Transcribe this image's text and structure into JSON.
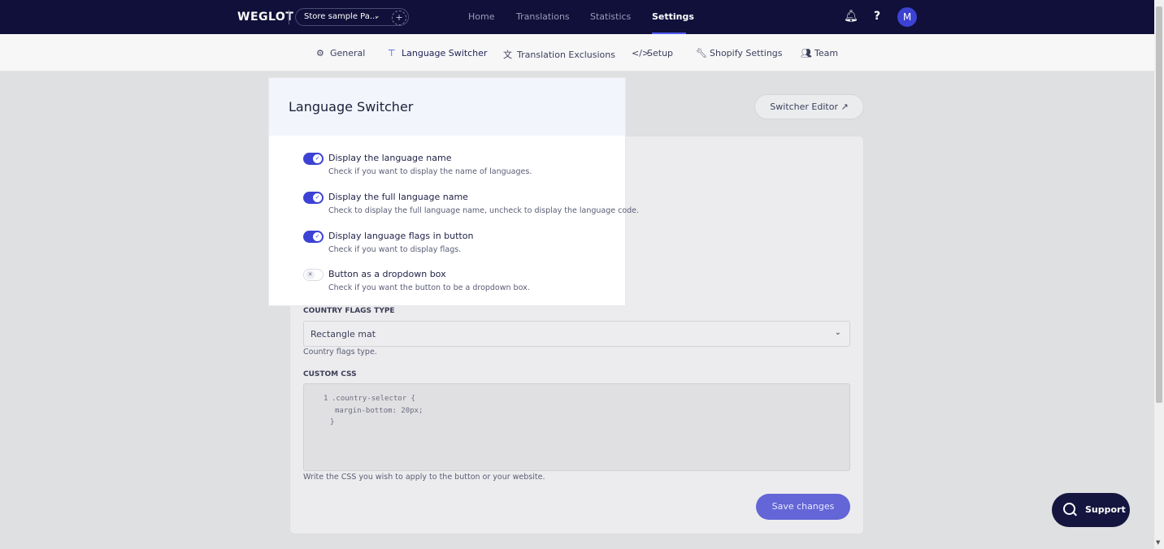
{
  "topbar": {
    "logo": "WEGLOT",
    "project": "Store sample Pa...",
    "project_add": "+",
    "nav": [
      "Home",
      "Translations",
      "Statistics",
      "Settings"
    ],
    "active_nav": "Settings",
    "avatar_initial": "M"
  },
  "subtabs": [
    {
      "label": "General",
      "icon": "gear-icon"
    },
    {
      "label": "Language Switcher",
      "icon": "paint-roller-icon"
    },
    {
      "label": "Translation Exclusions",
      "icon": "translate-icon"
    },
    {
      "label": "Setup",
      "icon": "code-icon"
    },
    {
      "label": "Shopify Settings",
      "icon": "wrench-icon"
    },
    {
      "label": "Team",
      "icon": "team-icon"
    }
  ],
  "page": {
    "switcher_editor_label": "Switcher Editor",
    "flags_type_label": "COUNTRY FLAGS TYPE",
    "flags_type_value": "Rectangle mat",
    "flags_type_help": "Country flags type.",
    "custom_css_label": "CUSTOM CSS",
    "custom_css_line_number": "1",
    "custom_css_lines": [
      ".country-selector {",
      "margin-bottom: 20px;",
      "}"
    ],
    "custom_css_help": "Write the CSS you wish to apply to the button or your website.",
    "save_label": "Save changes",
    "support_label": "Support"
  },
  "popup": {
    "title": "Language Switcher",
    "options": [
      {
        "label": "Display the language name",
        "description": "Check if you want to display the name of languages.",
        "checked": true
      },
      {
        "label": "Display the full language name",
        "description": "Check to display the full language name, uncheck to display the language code.",
        "checked": true
      },
      {
        "label": "Display language flags in button",
        "description": "Check if you want to display flags.",
        "checked": true
      },
      {
        "label": "Button as a dropdown box",
        "description": "Check if you want the button to be a dropdown box.",
        "checked": false
      }
    ]
  },
  "colors": {
    "topbar_bg": "#10103a",
    "accent": "#3c42d4",
    "save_button": "#6465d6",
    "support_button": "#15163f"
  }
}
